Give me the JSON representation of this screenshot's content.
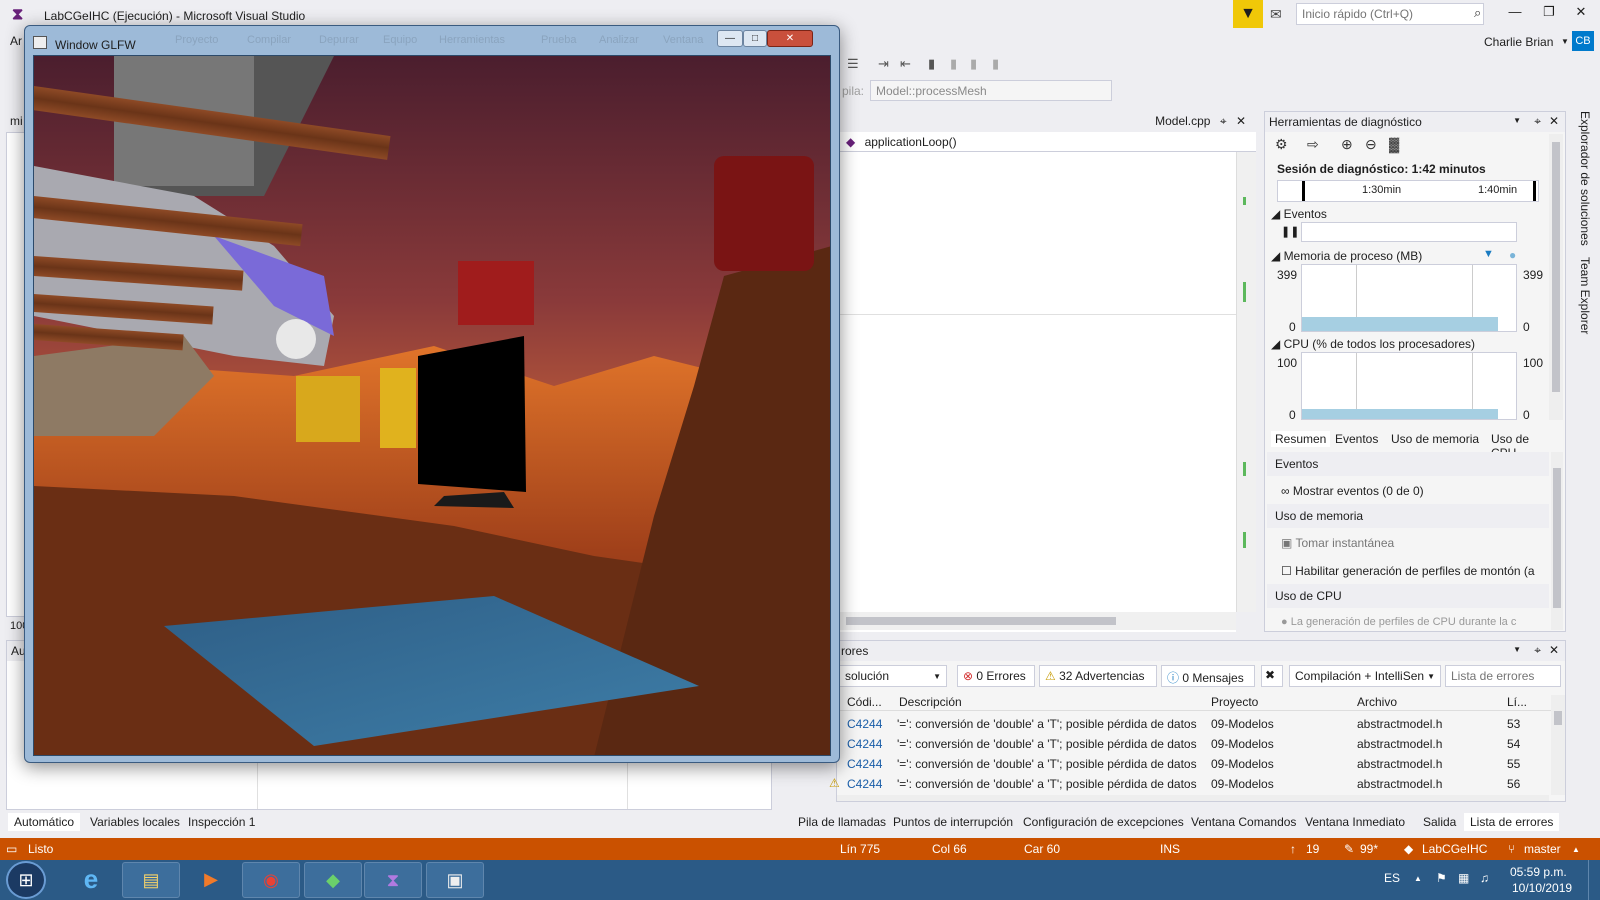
{
  "app": {
    "title": "LabCGeIHC (Ejecución) - Microsoft Visual Studio",
    "quick_launch_placeholder": "Inicio rápido (Ctrl+Q)",
    "user_name": "Charlie Brian",
    "user_initials": "CB",
    "menu_partial": "Ar"
  },
  "toolbar": {
    "stack_label": "pila:",
    "stack_value": "Model::processMesh"
  },
  "editor": {
    "tab_label": "Model.cpp",
    "nav_member": "applicationLoop()",
    "left_tab_partial": "mi"
  },
  "diagnostics": {
    "title": "Herramientas de diagnóstico",
    "session": "Sesión de diagnóstico: 1:42 minutos",
    "timeline_marks": [
      "1:30min",
      "1:40min"
    ],
    "events_label": "Eventos",
    "memory_label": "Memoria de proceso (MB)",
    "memory_max": "399",
    "memory_min": "0",
    "cpu_label": "CPU (% de todos los procesadores)",
    "cpu_max": "100",
    "cpu_min": "0",
    "tabs": [
      "Resumen",
      "Eventos",
      "Uso de memoria",
      "Uso de CPU"
    ],
    "section_events": "Eventos",
    "show_events": "Mostrar eventos (0 de 0)",
    "section_memory": "Uso de memoria",
    "take_snapshot": "Tomar instantánea",
    "enable_heap": "Habilitar generación de perfiles de montón (a",
    "section_cpu": "Uso de CPU",
    "cpu_note": "La generación de perfiles de CPU durante la c"
  },
  "side_tabs": [
    "Explorador de soluciones",
    "Team Explorer"
  ],
  "errors": {
    "title_partial": "rores",
    "scope": "solución",
    "errors_count": "0 Errores",
    "warnings_count": "32 Advertencias",
    "messages_count": "0 Mensajes",
    "build_filter": "Compilación + IntelliSen",
    "search_placeholder": "Lista de errores",
    "columns": [
      "Códi...",
      "Descripción",
      "Proyecto",
      "Archivo",
      "Lí..."
    ],
    "rows": [
      {
        "code": "C4244",
        "desc": "'=': conversión de 'double' a 'T'; posible pérdida de datos",
        "project": "09-Modelos",
        "file": "abstractmodel.h",
        "line": "53"
      },
      {
        "code": "C4244",
        "desc": "'=': conversión de 'double' a 'T'; posible pérdida de datos",
        "project": "09-Modelos",
        "file": "abstractmodel.h",
        "line": "54"
      },
      {
        "code": "C4244",
        "desc": "'=': conversión de 'double' a 'T'; posible pérdida de datos",
        "project": "09-Modelos",
        "file": "abstractmodel.h",
        "line": "55"
      },
      {
        "code": "C4244",
        "desc": "'=': conversión de 'double' a 'T'; posible pérdida de datos",
        "project": "09-Modelos",
        "file": "abstractmodel.h",
        "line": "56"
      }
    ]
  },
  "bottom_left_tabs": [
    "Automático",
    "Variables locales",
    "Inspección 1"
  ],
  "bottom_right_tabs": [
    "Pila de llamadas",
    "Puntos de interrupción",
    "Configuración de excepciones",
    "Ventana Comandos",
    "Ventana Inmediato",
    "Salida",
    "Lista de errores"
  ],
  "locals_partial": "Au",
  "zoom_partial": "100",
  "status": {
    "state": "Listo",
    "line": "Lín 775",
    "col": "Col 66",
    "char": "Car 60",
    "mode": "INS",
    "up_count": "19",
    "pencil_count": "99*",
    "repo": "LabCGeIHC",
    "branch": "master"
  },
  "taskbar": {
    "language": "ES",
    "time": "05:59 p.m.",
    "date": "10/10/2019"
  },
  "glfw": {
    "title": "Window GLFW",
    "menu_ghost": [
      "Proyecto",
      "Compilar",
      "Depurar",
      "Equipo",
      "Herramientas",
      "Prueba",
      "Analizar",
      "Ventana"
    ]
  },
  "colors": {
    "vs_accent": "#007ACC",
    "status_bar": "#CA5100",
    "taskbar": "#2B5A86",
    "warning": "#F0C808"
  }
}
